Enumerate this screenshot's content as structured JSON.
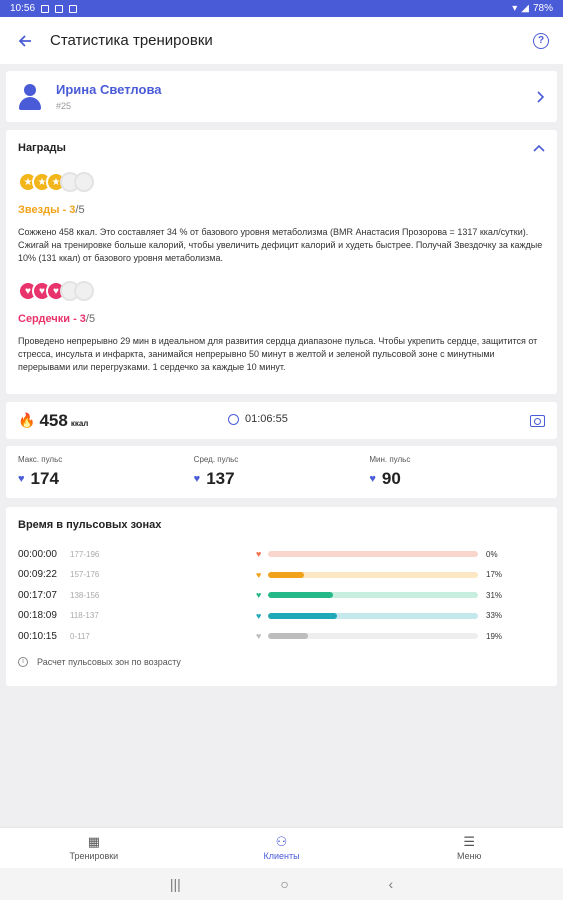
{
  "status_bar": {
    "time": "10:56",
    "battery": "78%"
  },
  "header": {
    "title": "Статистика тренировки"
  },
  "user": {
    "name": "Ирина Светлова",
    "id": "#25"
  },
  "awards": {
    "title": "Награды",
    "stars": {
      "label": "Звезды",
      "earned": "3",
      "total": "/5",
      "description": "Сожжено 458 ккал. Это составляет 34 % от базового уровня метаболизма (BMR Анастасия Прозорова = 1317 ккал/сутки). Сжигай на тренировке больше калорий, чтобы увеличить дефицит калорий и худеть быстрее. Получай Звездочку за каждые 10% (131 ккал) от базового уровня метаболизма."
    },
    "hearts": {
      "label": "Сердечки",
      "earned": "3",
      "total": "/5",
      "description": "Проведено непрерывно 29 мин в идеальном для развития сердца диапазоне пульса. Чтобы укрепить сердце, защитится от стресса, инсульта и инфаркта, занимайся непрерывно 50 минут в желтой и зеленой пульсовой зоне с минутными перерывами или перегрузками. 1 сердечко за каждые 10 минут."
    }
  },
  "summary": {
    "calories": "458",
    "calories_unit": "ккал",
    "duration": "01:06:55"
  },
  "pulse": {
    "max_label": "Макс. пульс",
    "max_value": "174",
    "avg_label": "Сред. пульс",
    "avg_value": "137",
    "min_label": "Мин. пульс",
    "min_value": "90"
  },
  "zones": {
    "title": "Время в пульсовых зонах",
    "note": "Расчет пульсовых зон по возрасту",
    "rows": [
      {
        "time": "00:00:00",
        "range": "177-196",
        "percent": "0%",
        "fraction": 0.0,
        "color": "#f0704a",
        "track": "#f9d6cb"
      },
      {
        "time": "00:09:22",
        "range": "157-176",
        "percent": "17%",
        "fraction": 0.17,
        "color": "#f2a21a",
        "track": "#fbe7c4"
      },
      {
        "time": "00:17:07",
        "range": "138-156",
        "percent": "31%",
        "fraction": 0.31,
        "color": "#25b98a",
        "track": "#c7eedf"
      },
      {
        "time": "00:18:09",
        "range": "118-137",
        "percent": "33%",
        "fraction": 0.33,
        "color": "#1fa9b8",
        "track": "#c4e8ec"
      },
      {
        "time": "00:10:15",
        "range": "0-117",
        "percent": "19%",
        "fraction": 0.19,
        "color": "#bdbdbd",
        "track": "#eeeeee"
      }
    ]
  },
  "nav": {
    "workouts": "Тренировки",
    "clients": "Клиенты",
    "menu": "Меню"
  }
}
